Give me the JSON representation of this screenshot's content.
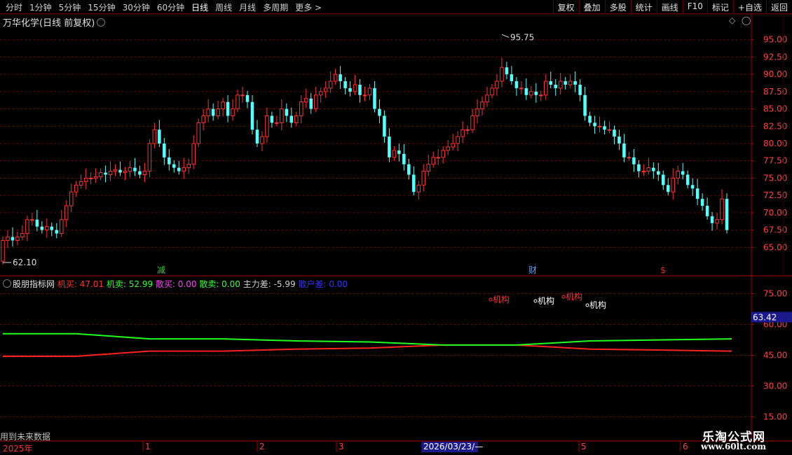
{
  "toolbar": {
    "periods": [
      "分时",
      "1分钟",
      "5分钟",
      "15分钟",
      "30分钟",
      "60分钟",
      "日线",
      "周线",
      "月线",
      "多周期",
      "更多"
    ],
    "active_period": "日线",
    "tools": [
      "复权",
      "叠加",
      "多股",
      "统计",
      "画线",
      "F10",
      "标记",
      "+自选",
      "返回"
    ]
  },
  "main_chart": {
    "title": "万华化学(日线 前复权)",
    "high_label": "95.75",
    "low_label": "62.10",
    "y_ticks": [
      "95.00",
      "92.50",
      "90.00",
      "87.50",
      "85.00",
      "82.50",
      "80.00",
      "77.50",
      "75.00",
      "72.50",
      "70.00",
      "67.50",
      "65.00"
    ],
    "markers": [
      {
        "text": "减",
        "color": "#3cc83c"
      },
      {
        "text": "财",
        "color": "#5aa0ff"
      },
      {
        "text": "$",
        "color": "#ff2020"
      }
    ]
  },
  "indicator": {
    "name": "股朋指标网",
    "items": [
      {
        "label": "机买: 47.01",
        "color": "#ff3030"
      },
      {
        "label": "机卖: 52.99",
        "color": "#30ff30"
      },
      {
        "label": "散买: 0.00",
        "color": "#ff40ff"
      },
      {
        "label": "散卖: 0.00",
        "color": "#30ff30"
      },
      {
        "label": "主力差: -5.99",
        "color": "#d0d0d0"
      },
      {
        "label": "散户差: 0.00",
        "color": "#3030ff"
      }
    ],
    "y_ticks": [
      "75.00",
      "60.00",
      "45.00",
      "30.00",
      "15.00"
    ],
    "current_value": "63.42",
    "annotations": [
      {
        "text": "机构",
        "color": "#ff3030"
      },
      {
        "text": "机构",
        "color": "#ffffff"
      },
      {
        "text": "机构",
        "color": "#ff3030"
      },
      {
        "text": "机构",
        "color": "#ffffff"
      }
    ]
  },
  "footer": {
    "future_note": "用到未来数据",
    "year_label": "2025年",
    "month_labels": [
      "1",
      "2",
      "3",
      "5",
      "6"
    ],
    "cursor_date": "2026/03/23/—"
  },
  "watermark": {
    "line1": "乐淘公式网",
    "line2": "www.60lt.com"
  },
  "chart_data": [
    {
      "type": "candlestick",
      "title": "万华化学(日线 前复权)",
      "ylim": [
        62,
        97.5
      ],
      "x": [
        0,
        1,
        2,
        3,
        4,
        5,
        6,
        7,
        8,
        9,
        10,
        11,
        12,
        13,
        14,
        15,
        16,
        17,
        18,
        19,
        20,
        21,
        22,
        23,
        24,
        25,
        26,
        27,
        28,
        29,
        30,
        31,
        32,
        33,
        34,
        35,
        36,
        37,
        38,
        39,
        40,
        41,
        42,
        43,
        44,
        45,
        46,
        47,
        48,
        49,
        50,
        51,
        52,
        53,
        54,
        55,
        56,
        57,
        58,
        59,
        60,
        61,
        62,
        63,
        64,
        65,
        66,
        67,
        68,
        69,
        70,
        71,
        72,
        73,
        74,
        75,
        76,
        77,
        78,
        79,
        80,
        81,
        82,
        83,
        84,
        85,
        86,
        87,
        88,
        89,
        90,
        91,
        92,
        93,
        94,
        95,
        96,
        97,
        98,
        99,
        100,
        101,
        102,
        103,
        104,
        105,
        106,
        107,
        108,
        109,
        110,
        111,
        112,
        113,
        114,
        115,
        116,
        117,
        118,
        119,
        120,
        121,
        122,
        123,
        124,
        125,
        126,
        127,
        128,
        129,
        130,
        131,
        132,
        133,
        134,
        135,
        136,
        137,
        138,
        139,
        140,
        141,
        142,
        143,
        144,
        145,
        146,
        147,
        148,
        149
      ],
      "open": [
        63,
        66,
        66.5,
        66,
        66.5,
        67,
        69,
        69,
        68,
        67.5,
        68,
        67.5,
        67,
        69,
        71,
        73,
        74,
        74.5,
        75,
        75,
        75.2,
        75.8,
        75.5,
        76,
        76.2,
        75.8,
        76,
        76.5,
        76,
        75.5,
        76,
        80,
        82,
        80,
        78,
        77,
        76.5,
        76,
        76.5,
        77,
        80,
        83,
        84,
        85,
        84,
        85,
        86,
        84,
        85,
        87,
        87,
        86,
        82,
        80,
        81,
        84,
        83,
        83,
        85,
        84,
        83,
        84,
        86,
        86.5,
        85,
        87,
        87.5,
        88,
        89,
        90,
        89,
        88,
        87.5,
        88.5,
        87,
        87,
        88,
        85,
        84,
        81,
        78,
        79,
        78.5,
        77,
        75.5,
        73,
        74,
        76,
        77,
        78,
        78,
        79,
        79.5,
        80,
        81,
        82,
        82,
        84,
        85,
        86,
        87,
        88,
        89,
        91,
        90,
        89,
        88,
        88,
        87,
        87.5,
        87,
        87,
        89,
        88.5,
        88,
        89,
        88.5,
        89,
        88.5,
        87,
        84,
        83,
        82.5,
        82.5,
        82,
        82,
        81,
        80,
        78,
        78,
        77,
        76,
        76,
        76.5,
        76,
        75.5,
        74,
        73,
        75,
        76,
        75.5,
        74,
        73.5,
        72,
        71,
        69.5,
        68.5,
        69,
        72
      ],
      "close": [
        66,
        66.5,
        66,
        66.5,
        67,
        69,
        69,
        68,
        67.5,
        68,
        67.5,
        67,
        69,
        71,
        73,
        74,
        74.5,
        75,
        75,
        75.2,
        75.8,
        75.5,
        76,
        76.2,
        75.8,
        76,
        76.5,
        76,
        75.5,
        76,
        80,
        82,
        80,
        78,
        77,
        76.5,
        76,
        76.5,
        77,
        80,
        83,
        84,
        85,
        84,
        85,
        86,
        84,
        85,
        87,
        87,
        86,
        82,
        80,
        81,
        84,
        83,
        83,
        85,
        84,
        83,
        84,
        86,
        86.5,
        85,
        87,
        87.5,
        88,
        89,
        90,
        89,
        88,
        87.5,
        88.5,
        87,
        87,
        88,
        85,
        84,
        81,
        78,
        79,
        78.5,
        77,
        75.5,
        73,
        74,
        76,
        77,
        78,
        78,
        79,
        79.5,
        80,
        81,
        82,
        82,
        84,
        85,
        86,
        87,
        88,
        89,
        91,
        90,
        89,
        88,
        88,
        87,
        87.5,
        87,
        87,
        89,
        88.5,
        88,
        89,
        88.5,
        89,
        88.5,
        87,
        84,
        83,
        82.5,
        82.5,
        82,
        82,
        81,
        80,
        78,
        78,
        77,
        76,
        76,
        76.5,
        76,
        75.5,
        74,
        73,
        75,
        76,
        75.5,
        74,
        73.5,
        72,
        71,
        69.5,
        68.5,
        69,
        72,
        67.5
      ]
    },
    {
      "type": "line",
      "title": "股朋指标网",
      "ylim": [
        10,
        80
      ],
      "series": [
        {
          "name": "机买",
          "color": "#ff2020",
          "x": [
            0,
            15,
            30,
            45,
            60,
            75,
            90,
            105,
            120,
            135,
            149
          ],
          "y": [
            44.5,
            44.5,
            47,
            47,
            48,
            48.5,
            50,
            50,
            48,
            47.5,
            47
          ]
        },
        {
          "name": "机卖",
          "color": "#20ff20",
          "x": [
            0,
            15,
            30,
            45,
            60,
            75,
            90,
            105,
            120,
            135,
            149
          ],
          "y": [
            55.5,
            55.5,
            53,
            53,
            52,
            51.5,
            50,
            50,
            52,
            52.5,
            53
          ]
        }
      ]
    }
  ]
}
